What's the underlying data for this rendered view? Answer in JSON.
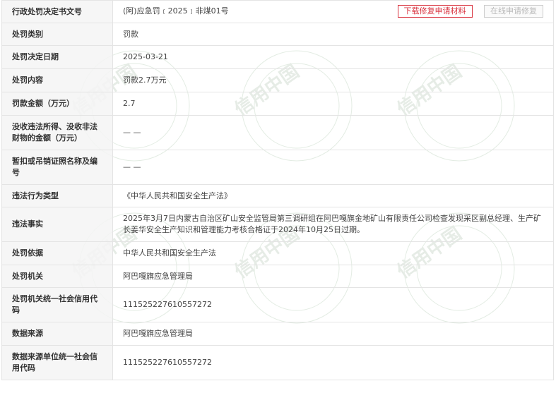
{
  "header": {
    "label": "行政处罚决定书文号",
    "value": "(阿)应急罚﹝2025﹞非煤01号",
    "download_button": "下载修复申请材料",
    "online_button": "在线申请修复"
  },
  "rows": [
    {
      "label": "处罚类别",
      "value": "罚款"
    },
    {
      "label": "处罚决定日期",
      "value": "2025-03-21"
    },
    {
      "label": "处罚内容",
      "value": "罚款2.7万元"
    },
    {
      "label": "罚款金额（万元）",
      "value": "2.7"
    },
    {
      "label": "没收违法所得、没收非法财物的金额（万元）",
      "value": "— —"
    },
    {
      "label": "暂扣或吊销证照名称及编号",
      "value": "— —"
    },
    {
      "label": "违法行为类型",
      "value": "《中华人民共和国安全生产法》"
    },
    {
      "label": "违法事实",
      "value": "2025年3月7日内蒙古自治区矿山安全监管局第三调研组在阿巴嘎旗金地矿山有限责任公司检查发现采区副总经理、生产矿长姜华安全生产知识和管理能力考核合格证于2024年10月25日过期。"
    },
    {
      "label": "处罚依据",
      "value": "中华人民共和国安全生产法"
    },
    {
      "label": "处罚机关",
      "value": "阿巴嘎旗应急管理局"
    },
    {
      "label": "处罚机关统一社会信用代码",
      "value": "111525227610557272"
    },
    {
      "label": "数据来源",
      "value": "阿巴嘎旗应急管理局"
    },
    {
      "label": "数据来源单位统一社会信用代码",
      "value": "111525227610557272"
    }
  ],
  "watermark": {
    "text": "信用中国",
    "color": "#e2e8e2"
  }
}
